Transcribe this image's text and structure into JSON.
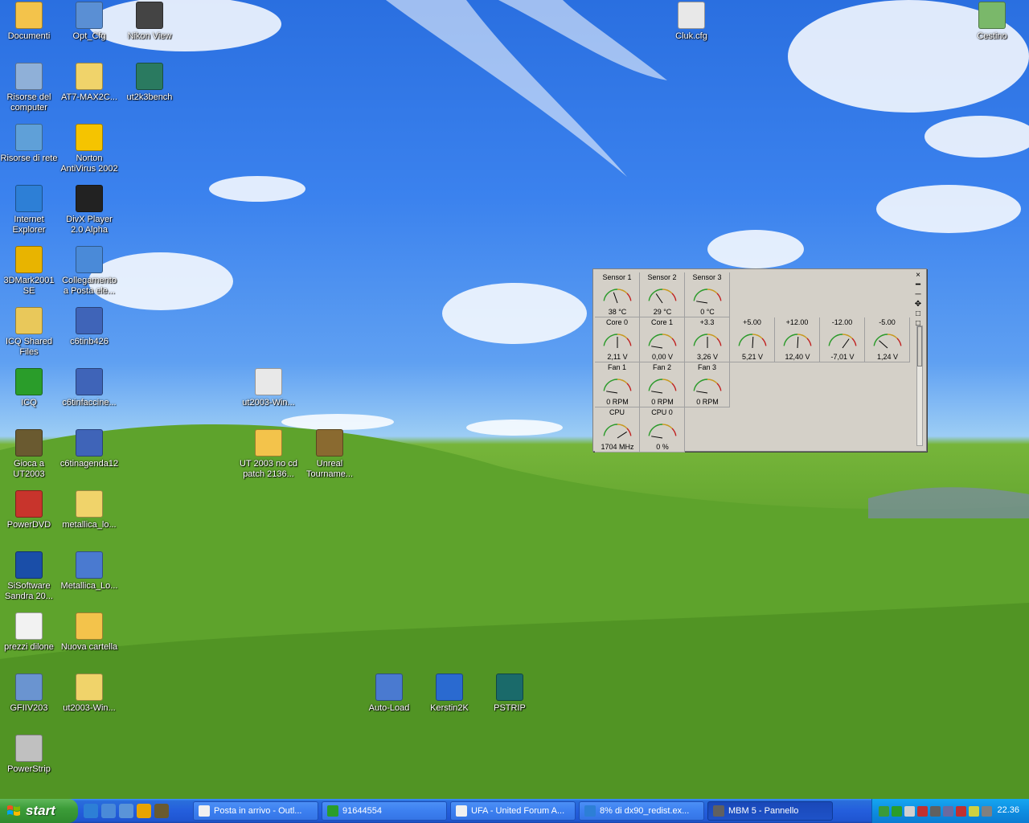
{
  "desktop_icons": [
    {
      "label": "Documenti",
      "icon": "folder-documents-icon",
      "color": "#f3c34b"
    },
    {
      "label": "Opt_Cfg",
      "icon": "config-app-icon",
      "color": "#5a8fd4"
    },
    {
      "label": "Nikon View",
      "icon": "camera-icon",
      "color": "#444444"
    },
    {
      "label": "Risorse del computer",
      "icon": "my-computer-icon",
      "color": "#8fb0d8"
    },
    {
      "label": "AT7-MAX2C...",
      "icon": "zip-folder-icon",
      "color": "#f0d36a"
    },
    {
      "label": "ut2k3bench",
      "icon": "benchmark-icon",
      "color": "#2a7a60"
    },
    {
      "label": "Risorse di rete",
      "icon": "network-icon",
      "color": "#5fa0d8"
    },
    {
      "label": "Norton AntiVirus 2002",
      "icon": "norton-icon",
      "color": "#f5c400"
    },
    {
      "label": "Internet Explorer",
      "icon": "internet-explorer-icon",
      "color": "#2d7fd6"
    },
    {
      "label": "DivX Player 2.0 Alpha",
      "icon": "divx-icon",
      "color": "#222222"
    },
    {
      "label": "3DMark2001 SE",
      "icon": "3dmark-icon",
      "color": "#e8b400"
    },
    {
      "label": "Collegamento a Posta ele...",
      "icon": "mail-shortcut-icon",
      "color": "#4a8ad8"
    },
    {
      "label": "ICQ Shared Files",
      "icon": "icq-folder-icon",
      "color": "#e9c85a"
    },
    {
      "label": "c6tinb426",
      "icon": "installer-icon",
      "color": "#3f64b8"
    },
    {
      "label": "ICQ",
      "icon": "icq-flower-icon",
      "color": "#2a9d2a"
    },
    {
      "label": "c6tinfaccine...",
      "icon": "installer-icon",
      "color": "#3f64b8"
    },
    {
      "label": "Gioca a UT2003",
      "icon": "unreal-icon",
      "color": "#6a5a30"
    },
    {
      "label": "c6tinagenda12",
      "icon": "installer-icon",
      "color": "#3f64b8"
    },
    {
      "label": "PowerDVD",
      "icon": "powerdvd-icon",
      "color": "#c8342c"
    },
    {
      "label": "metallica_lo...",
      "icon": "zip-folder-icon",
      "color": "#f0d36a"
    },
    {
      "label": "SiSoftware Sandra 20...",
      "icon": "sandra-icon",
      "color": "#1a4ea8"
    },
    {
      "label": "Metallica_Lo...",
      "icon": "media-file-icon",
      "color": "#4a7ad0"
    },
    {
      "label": "prezzi dilone",
      "icon": "envelope-icon",
      "color": "#f2f2f2"
    },
    {
      "label": "Nuova cartella",
      "icon": "folder-icon",
      "color": "#f3c34b"
    },
    {
      "label": "GFIIV203",
      "icon": "gfi-icon",
      "color": "#6a94d0"
    },
    {
      "label": "ut2003-Win...",
      "icon": "zip-folder-icon",
      "color": "#f0d36a"
    },
    {
      "label": "PowerStrip",
      "icon": "powerstrip-icon",
      "color": "#c0c0c0"
    },
    {
      "label": "ut2003-Win...",
      "icon": "text-file-icon",
      "color": "#e8e8e8"
    },
    {
      "label": "UT 2003 no cd patch 2136...",
      "icon": "folder-icon",
      "color": "#f3c34b"
    },
    {
      "label": "Unreal Tourname...",
      "icon": "unreal-tournament-icon",
      "color": "#8a6a30"
    },
    {
      "label": "Cluk.cfg",
      "icon": "cfg-file-icon",
      "color": "#e8e8e8"
    },
    {
      "label": "Cestino",
      "icon": "recycle-bin-icon",
      "color": "#7ab86a"
    },
    {
      "label": "Auto-Load",
      "icon": "autoload-icon",
      "color": "#4a7ad0"
    },
    {
      "label": "Kerstin2K",
      "icon": "info-icon",
      "color": "#2a6ad0"
    },
    {
      "label": "PSTRIP",
      "icon": "pstrip-icon",
      "color": "#1a6a6a"
    }
  ],
  "mbm": {
    "close": "×",
    "rows": [
      [
        {
          "name": "Sensor 1",
          "value": "38 °C",
          "level": 0.38
        },
        {
          "name": "Sensor 2",
          "value": "29 °C",
          "level": 0.29
        },
        {
          "name": "Sensor 3",
          "value": "0 °C",
          "level": 0.0
        }
      ],
      [
        {
          "name": "Core 0",
          "value": "2,11 V",
          "level": 0.5
        },
        {
          "name": "Core 1",
          "value": "0,00 V",
          "level": 0.0
        },
        {
          "name": "+3.3",
          "value": "3,26 V",
          "level": 0.5
        },
        {
          "name": "+5.00",
          "value": "5,21 V",
          "level": 0.52
        },
        {
          "name": "+12.00",
          "value": "12,40 V",
          "level": 0.52
        },
        {
          "name": "-12.00",
          "value": "-7,01 V",
          "level": 0.72
        },
        {
          "name": "-5.00",
          "value": "1,24 V",
          "level": 0.2
        }
      ],
      [
        {
          "name": "Fan 1",
          "value": "0 RPM",
          "level": 0.0
        },
        {
          "name": "Fan 2",
          "value": "0 RPM",
          "level": 0.0
        },
        {
          "name": "Fan 3",
          "value": "0 RPM",
          "level": 0.0
        }
      ],
      [
        {
          "name": "CPU",
          "value": "1704 MHz",
          "level": 0.85
        },
        {
          "name": "CPU 0",
          "value": "0 %",
          "level": 0.0
        }
      ]
    ]
  },
  "taskbar": {
    "start_label": "start",
    "quick_launch": [
      {
        "icon": "ie-quick-icon",
        "color": "#2d7fd6"
      },
      {
        "icon": "outlook-quick-icon",
        "color": "#4a8ad8"
      },
      {
        "icon": "desktop-quick-icon",
        "color": "#5a94d8"
      },
      {
        "icon": "media-player-quick-icon",
        "color": "#e8a400"
      },
      {
        "icon": "unreal-quick-icon",
        "color": "#6a5a30"
      }
    ],
    "tasks": [
      {
        "label": "Posta in arrivo - Outl...",
        "icon": "outlook-task-icon",
        "color": "#f0f0f0",
        "active": false
      },
      {
        "label": "91644554",
        "icon": "icq-task-icon",
        "color": "#2a9d2a",
        "active": false
      },
      {
        "label": "UFA - United Forum A...",
        "icon": "ie-task-icon",
        "color": "#f0f0f0",
        "active": false
      },
      {
        "label": "8% di dx90_redist.ex...",
        "icon": "download-task-icon",
        "color": "#2d7fd6",
        "active": false
      },
      {
        "label": "MBM 5 - Pannello",
        "icon": "mbm-task-icon",
        "color": "#606060",
        "active": true
      }
    ],
    "tray_icons": [
      "#3a9a3a",
      "#2a9d2a",
      "#d0d0d0",
      "#c03030",
      "#606060",
      "#6a6aa0",
      "#c03030",
      "#d0d040",
      "#808080"
    ],
    "clock": "22.36"
  }
}
